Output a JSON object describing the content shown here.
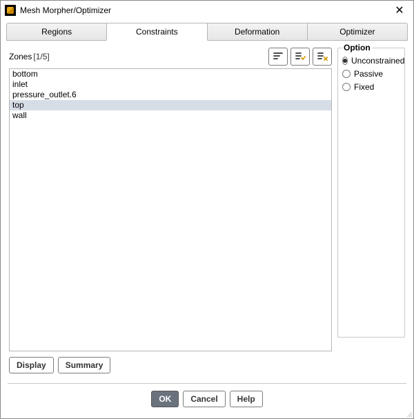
{
  "window": {
    "title": "Mesh Morpher/Optimizer"
  },
  "tabs": [
    {
      "label": "Regions",
      "active": false
    },
    {
      "label": "Constraints",
      "active": true
    },
    {
      "label": "Deformation",
      "active": false
    },
    {
      "label": "Optimizer",
      "active": false
    }
  ],
  "zones": {
    "label": "Zones",
    "count_text": "[1/5]",
    "items": [
      {
        "name": "bottom",
        "selected": false
      },
      {
        "name": "inlet",
        "selected": false
      },
      {
        "name": "pressure_outlet.6",
        "selected": false
      },
      {
        "name": "top",
        "selected": true
      },
      {
        "name": "wall",
        "selected": false
      }
    ]
  },
  "option": {
    "title": "Option",
    "choices": [
      {
        "label": "Unconstrained",
        "checked": true
      },
      {
        "label": "Passive",
        "checked": false
      },
      {
        "label": "Fixed",
        "checked": false
      }
    ]
  },
  "buttons": {
    "display": "Display",
    "summary": "Summary",
    "ok": "OK",
    "cancel": "Cancel",
    "help": "Help"
  }
}
